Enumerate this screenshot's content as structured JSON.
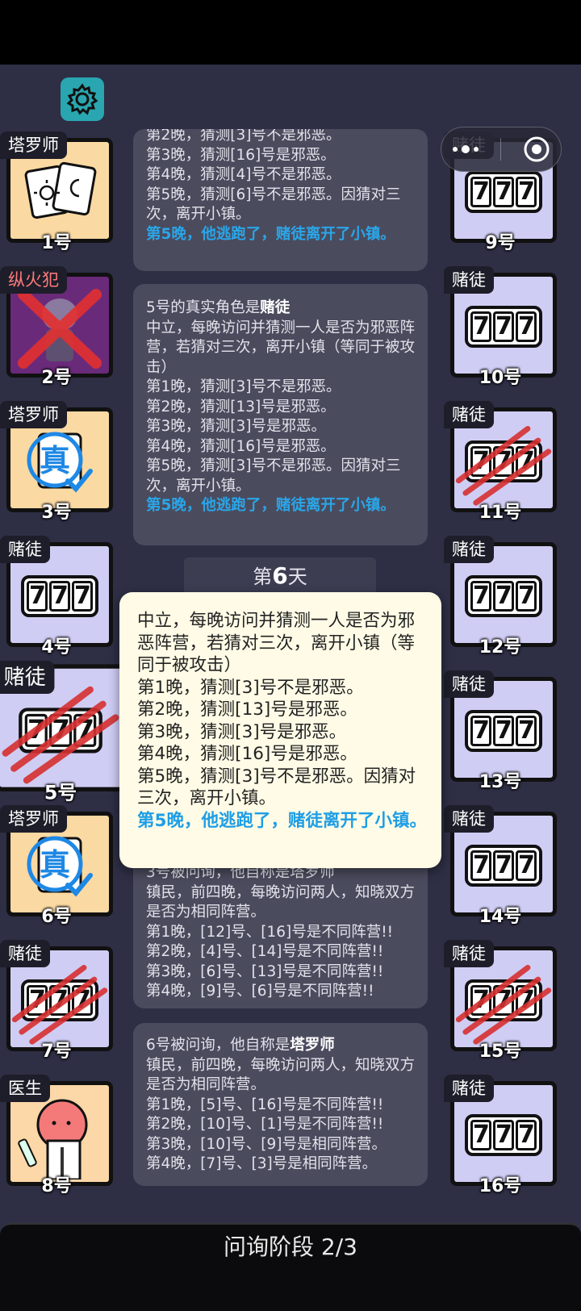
{
  "toolbar": {
    "settings_icon": "gear-icon",
    "capsule_menu_icon": "more-dots-icon",
    "capsule_close_icon": "target-circle-icon"
  },
  "players_left": [
    {
      "role": "塔罗师",
      "num": "1号",
      "art": "tarot",
      "bg": "beige",
      "dead": false,
      "truth": false
    },
    {
      "role": "纵火犯",
      "num": "2号",
      "art": "arsonist",
      "bg": "purple",
      "dead": true,
      "truth": false
    },
    {
      "role": "塔罗师",
      "num": "3号",
      "art": "truth",
      "bg": "beige",
      "dead": false,
      "truth": true
    },
    {
      "role": "赌徒",
      "num": "4号",
      "art": "slot",
      "bg": "lav",
      "dead": false,
      "truth": false
    },
    {
      "role": "赌徒",
      "num": "5号",
      "art": "slot",
      "bg": "lav",
      "dead": false,
      "clawed": true,
      "selected": true
    },
    {
      "role": "塔罗师",
      "num": "6号",
      "art": "truth",
      "bg": "beige",
      "dead": false,
      "truth": true
    },
    {
      "role": "赌徒",
      "num": "7号",
      "art": "slot",
      "bg": "lav",
      "dead": false,
      "clawed": true
    },
    {
      "role": "医生",
      "num": "8号",
      "art": "doctor",
      "bg": "pink",
      "dead": false
    }
  ],
  "players_right": [
    {
      "role": "赌徒",
      "num": "9号",
      "clawed": false
    },
    {
      "role": "赌徒",
      "num": "10号",
      "clawed": false
    },
    {
      "role": "赌徒",
      "num": "11号",
      "clawed": true
    },
    {
      "role": "赌徒",
      "num": "12号",
      "clawed": false
    },
    {
      "role": "赌徒",
      "num": "13号",
      "clawed": false
    },
    {
      "role": "赌徒",
      "num": "14号",
      "clawed": false
    },
    {
      "role": "赌徒",
      "num": "15号",
      "clawed": true
    },
    {
      "role": "赌徒",
      "num": "16号",
      "clawed": false
    }
  ],
  "slot_digits": [
    "7",
    "7",
    "7"
  ],
  "truth_glyph": "真",
  "log": {
    "msg1": {
      "top_partial": "第2晚，猜测[3]号不是邪恶。",
      "lines": [
        "第3晚，猜测[16]号是邪恶。",
        "第4晚，猜测[4]号不是邪恶。",
        "第5晚，猜测[6]号不是邪恶。因猜对三次，离开小镇。"
      ],
      "highlight": "第5晚，他逃跑了，赌徒离开了小镇。"
    },
    "msg2": {
      "title_prefix": "5号的真实角色是",
      "title_role": "赌徒",
      "desc": "中立，每晚访问并猜测一人是否为邪恶阵营，若猜对三次，离开小镇（等同于被攻击）",
      "lines": [
        "第1晚，猜测[3]号不是邪恶。",
        "第2晚，猜测[13]号是邪恶。",
        "第3晚，猜测[3]号是邪恶。",
        "第4晚，猜测[16]号是邪恶。",
        "第5晚，猜测[3]号不是邪恶。因猜对三次，离开小镇。"
      ],
      "highlight": "第5晚，他逃跑了，赌徒离开了小镇。"
    },
    "day_prefix": "第",
    "day_num": "6",
    "day_suffix": "天",
    "msg3": {
      "title_partial": "3号被问询，他自称是塔罗师",
      "desc": "镇民，前四晚，每晚访问两人，知晓双方是否为相同阵营。",
      "lines": [
        "第1晚，[12]号、[16]号是不同阵营!!",
        "第2晚，[4]号、[14]号是不同阵营!!",
        "第3晚，[6]号、[13]号是不同阵营!!",
        "第4晚，[9]号、[6]号是不同阵营!!"
      ]
    },
    "msg4": {
      "title_prefix": "6号被问询，他自称是",
      "title_role": "塔罗师",
      "desc": "镇民，前四晚，每晚访问两人，知晓双方是否为相同阵营。",
      "lines": [
        "第1晚，[5]号、[16]号是不同阵营!!",
        "第2晚，[10]号、[1]号是不同阵营!!",
        "第3晚，[10]号、[9]号是相同阵营。",
        "第4晚，[7]号、[3]号是相同阵营。"
      ]
    }
  },
  "popup": {
    "desc": "中立，每晚访问并猜测一人是否为邪恶阵营，若猜对三次，离开小镇（等同于被攻击）",
    "lines": [
      "第1晚，猜测[3]号不是邪恶。",
      "第2晚，猜测[13]号是邪恶。",
      "第3晚，猜测[3]号是邪恶。",
      "第4晚，猜测[16]号是邪恶。",
      "第5晚，猜测[3]号不是邪恶。因猜对三次，离开小镇。"
    ],
    "highlight": "第5晚，他逃跑了，赌徒离开了小镇。"
  },
  "phase": {
    "label": "问询阶段 2/3"
  },
  "colors": {
    "accent_blue": "#2aa6e8",
    "gear_teal": "#2aa6b0",
    "claw_red": "#d63030"
  }
}
